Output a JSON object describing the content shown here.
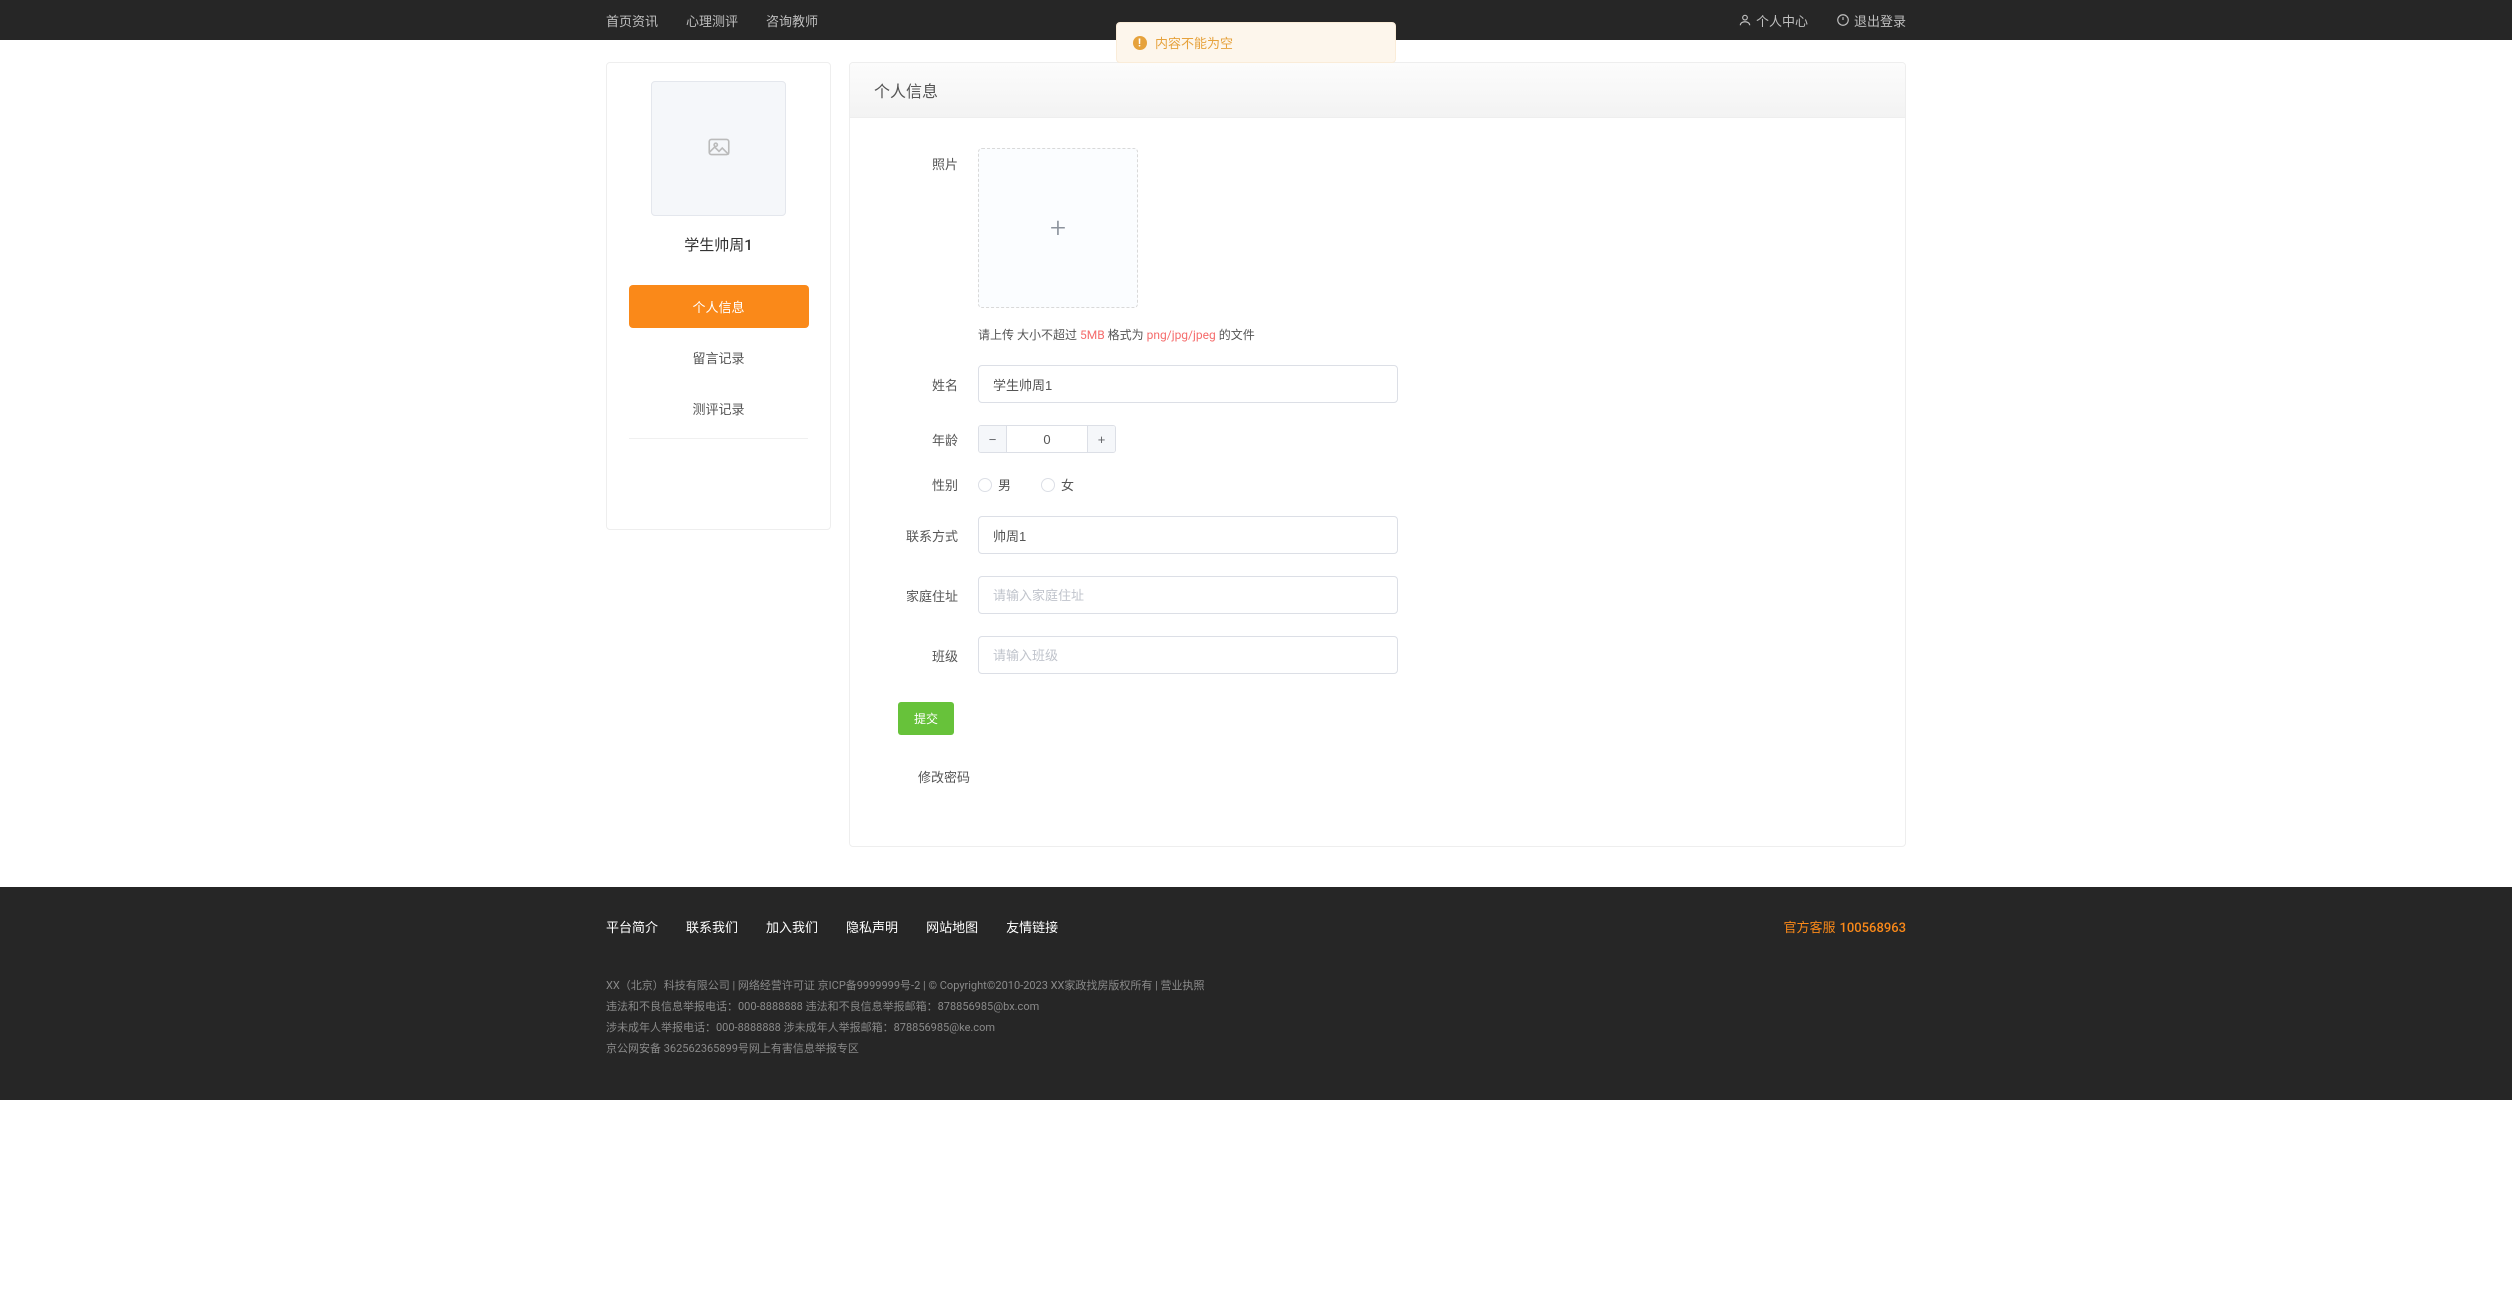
{
  "toast": {
    "message": "内容不能为空"
  },
  "topnav": {
    "left": [
      "首页资讯",
      "心理测评",
      "咨询教师"
    ],
    "right": [
      {
        "icon": "user-icon",
        "label": "个人中心"
      },
      {
        "icon": "logout-icon",
        "label": "退出登录"
      }
    ]
  },
  "sidebar": {
    "username": "学生帅周1",
    "items": [
      {
        "label": "个人信息",
        "active": true
      },
      {
        "label": "留言记录",
        "active": false
      },
      {
        "label": "测评记录",
        "active": false
      }
    ]
  },
  "panel": {
    "title": "个人信息"
  },
  "form": {
    "labels": {
      "photo": "照片",
      "name": "姓名",
      "age": "年龄",
      "gender": "性别",
      "contact": "联系方式",
      "address": "家庭住址",
      "class": "班级"
    },
    "hint": {
      "pre": "请上传 大小不超过 ",
      "size": "5MB",
      "mid": " 格式为 ",
      "formats": "png/jpg/jpeg",
      "post": " 的文件"
    },
    "name_value": "学生帅周1",
    "age_value": "0",
    "gender_options": [
      "男",
      "女"
    ],
    "contact_value": "帅周1",
    "address_placeholder": "请输入家庭住址",
    "class_placeholder": "请输入班级",
    "submit_label": "提交",
    "change_pwd": "修改密码"
  },
  "footer": {
    "links": [
      "平台简介",
      "联系我们",
      "加入我们",
      "隐私声明",
      "网站地图",
      "友情链接"
    ],
    "service_label": "官方客服",
    "service_number": "100568963",
    "legal": [
      "XX（北京）科技有限公司 | 网络经营许可证 京ICP备9999999号-2 | © Copyright©2010-2023 XX家政找房版权所有 | 营业执照",
      "违法和不良信息举报电话：000-8888888 违法和不良信息举报邮箱：878856985@bx.com",
      "涉未成年人举报电话：000-8888888 涉未成年人举报邮箱：878856985@ke.com",
      "京公网安备 362562365899号网上有害信息举报专区"
    ]
  }
}
